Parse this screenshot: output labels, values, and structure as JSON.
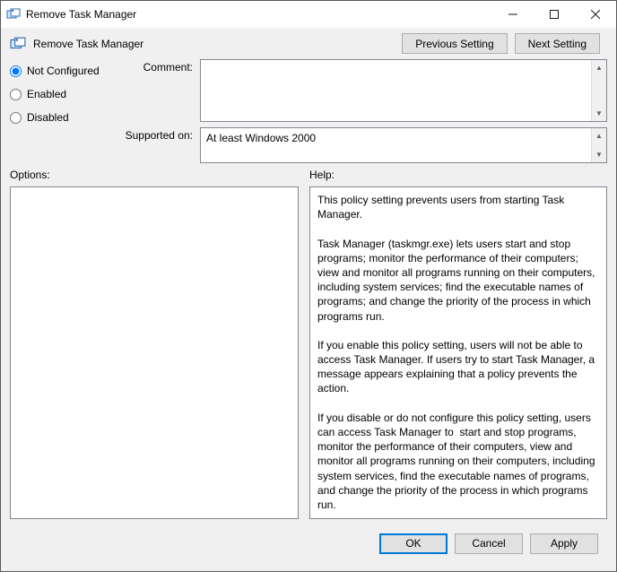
{
  "window": {
    "title": "Remove Task Manager"
  },
  "header": {
    "policy_name": "Remove Task Manager",
    "prev_btn": "Previous Setting",
    "next_btn": "Next Setting"
  },
  "state": {
    "not_configured": "Not Configured",
    "enabled": "Enabled",
    "disabled": "Disabled",
    "selected": "not_configured"
  },
  "fields": {
    "comment_label": "Comment:",
    "comment_value": "",
    "supported_label": "Supported on:",
    "supported_value": "At least Windows 2000"
  },
  "sections": {
    "options_label": "Options:",
    "help_label": "Help:"
  },
  "help_text": "This policy setting prevents users from starting Task Manager.\n\nTask Manager (taskmgr.exe) lets users start and stop programs; monitor the performance of their computers; view and monitor all programs running on their computers, including system services; find the executable names of programs; and change the priority of the process in which programs run.\n\nIf you enable this policy setting, users will not be able to access Task Manager. If users try to start Task Manager, a message appears explaining that a policy prevents the action.\n\nIf you disable or do not configure this policy setting, users can access Task Manager to  start and stop programs, monitor the performance of their computers, view and monitor all programs running on their computers, including system services, find the executable names of programs, and change the priority of the process in which programs run.",
  "buttons": {
    "ok": "OK",
    "cancel": "Cancel",
    "apply": "Apply"
  }
}
